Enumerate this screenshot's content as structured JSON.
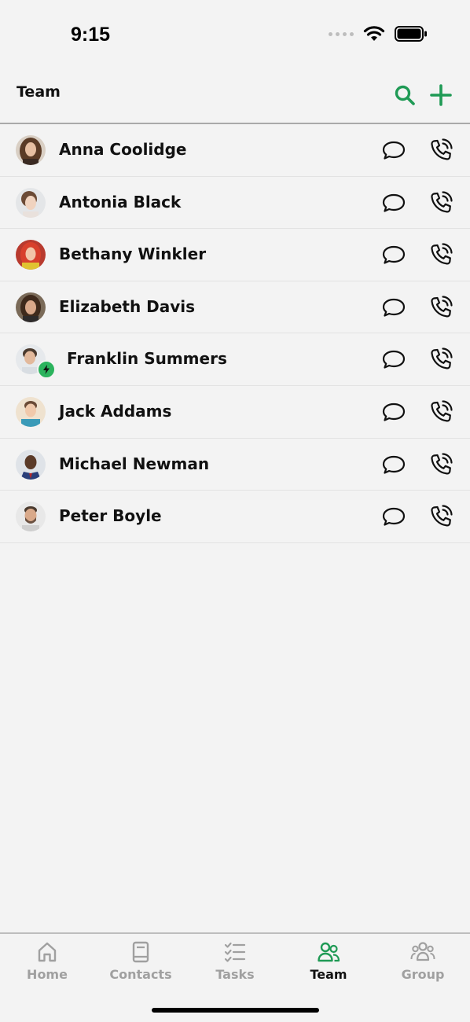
{
  "status_bar": {
    "time": "9:15"
  },
  "header": {
    "title": "Team",
    "search_icon": "search-icon",
    "add_icon": "plus-icon",
    "accent_color": "#1f9a55"
  },
  "members": [
    {
      "name": "Anna Coolidge",
      "avatar": "avatar-anna"
    },
    {
      "name": "Antonia Black",
      "avatar": "avatar-antonia"
    },
    {
      "name": "Bethany Winkler",
      "avatar": "avatar-bethany"
    },
    {
      "name": "Elizabeth Davis",
      "avatar": "avatar-elizabeth"
    },
    {
      "name": "Franklin Summers",
      "avatar": "avatar-franklin",
      "badge": "lightning-badge-icon"
    },
    {
      "name": "Jack Addams",
      "avatar": "avatar-jack"
    },
    {
      "name": "Michael Newman",
      "avatar": "avatar-michael"
    },
    {
      "name": "Peter Boyle",
      "avatar": "avatar-peter"
    }
  ],
  "row_actions": {
    "message_icon": "chat-bubble-icon",
    "call_icon": "phone-call-icon"
  },
  "tabs": [
    {
      "label": "Home",
      "icon": "home-icon",
      "active": false
    },
    {
      "label": "Contacts",
      "icon": "contacts-book-icon",
      "active": false
    },
    {
      "label": "Tasks",
      "icon": "tasks-checklist-icon",
      "active": false
    },
    {
      "label": "Team",
      "icon": "team-people-icon",
      "active": true
    },
    {
      "label": "Group",
      "icon": "group-icon",
      "active": false
    }
  ]
}
